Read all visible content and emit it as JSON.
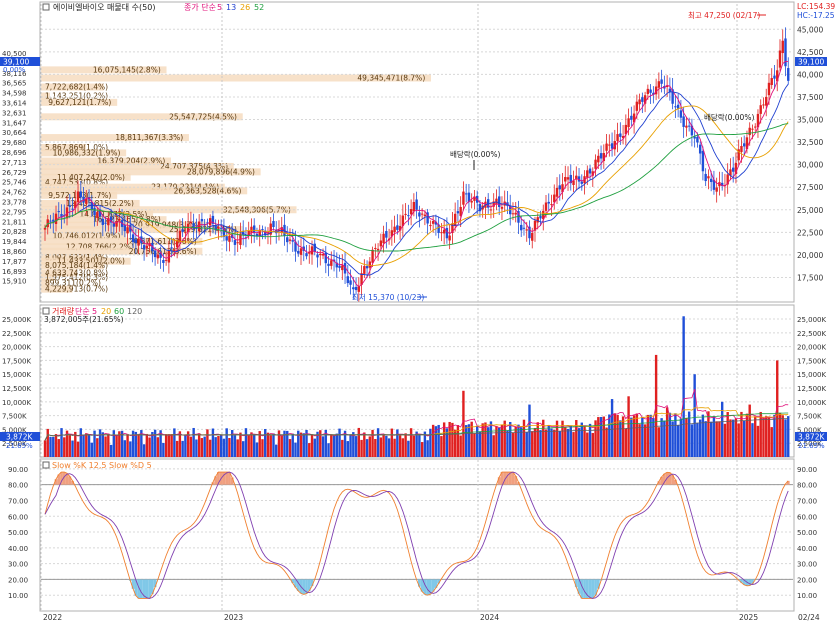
{
  "header": {
    "stock_name": "에이비엘바이오 매물대 수(50)",
    "ma_label": "종가 단순",
    "ma_periods": [
      "5",
      "13",
      "26",
      "52"
    ],
    "ma_colors": [
      "#e0107a",
      "#2040d0",
      "#e8a000",
      "#20a040"
    ],
    "lc": "LC:154.39",
    "hc": "HC:-17.25",
    "current_price": "39,100",
    "current_pct": "0.00%",
    "high_annot": "최고 47,250 (02/17)",
    "low_annot": "최저 15,370 (10/23)",
    "ex_div_1": "배당락(0.00%)",
    "ex_div_2": "배당락(0.00%)"
  },
  "volume_panel": {
    "label": "거래량",
    "ma_label": "단순",
    "ma_periods": [
      "5",
      "20",
      "60",
      "120"
    ],
    "ma_colors": [
      "#e0107a",
      "#e8a000",
      "#20a040",
      "#606060"
    ],
    "sub_label": "3,872,005주(21.65%)",
    "current": "3,872K",
    "current_pct": "21.65%"
  },
  "stoch_panel": {
    "label": "Slow %K 12,5  Slow %D 5",
    "k_color": "#f08030",
    "d_color": "#8040b0"
  },
  "colors": {
    "up": "#e02020",
    "down": "#1f4fd8",
    "profile": "#f6dcc0",
    "price_badge": "#1f4fd8"
  },
  "chart_data": {
    "type": "candlestick",
    "price_axis_right": [
      "45,000",
      "42,500",
      "40,000",
      "37,500",
      "35,000",
      "32,500",
      "30,000",
      "27,500",
      "25,000",
      "22,500",
      "20,000",
      "17,500"
    ],
    "price_axis_left": [
      "40,500",
      "39,100",
      "38,116",
      "36,565",
      "34,598",
      "33,614",
      "32,631",
      "31,647",
      "30,664",
      "29,680",
      "28,696",
      "27,713",
      "26,729",
      "25,746",
      "24,762",
      "23,778",
      "22,795",
      "21,811",
      "20,828",
      "19,844",
      "18,860",
      "17,877",
      "16,893",
      "15,910"
    ],
    "volume_axis": [
      "25,000K",
      "22,500K",
      "20,000K",
      "17,500K",
      "15,000K",
      "12,500K",
      "10,000K",
      "7,500K",
      "5,000K",
      "2,500K"
    ],
    "stoch_axis": [
      "90.00",
      "80.00",
      "70.00",
      "60.00",
      "50.00",
      "40.00",
      "30.00",
      "20.00",
      "10.00"
    ],
    "x_labels": [
      "2022",
      "2023",
      "2024",
      "2025",
      "02/24"
    ],
    "volume_profile": [
      {
        "price": 40500,
        "vol": "16,075,145(2.8%)",
        "pct": 2.8
      },
      {
        "price": 39600,
        "vol": "49,345,471(8.7%)",
        "pct": 8.7
      },
      {
        "price": 38600,
        "vol": "7,722,682(1.4%)",
        "pct": 1.4
      },
      {
        "price": 37600,
        "vol": "1,143,251(0.2%)",
        "pct": 0.2
      },
      {
        "price": 36900,
        "vol": "9,627,121(1.7%)",
        "pct": 1.7
      },
      {
        "price": 35300,
        "vol": "25,547,725(4.5%)",
        "pct": 4.5
      },
      {
        "price": 33000,
        "vol": "18,811,367(3.3%)",
        "pct": 3.3
      },
      {
        "price": 31900,
        "vol": "5,867,869(1.0%)",
        "pct": 1.0
      },
      {
        "price": 31300,
        "vol": "10,986,332(1.9%)",
        "pct": 1.9
      },
      {
        "price": 30400,
        "vol": "16,379,204(2.9%)",
        "pct": 2.9
      },
      {
        "price": 29800,
        "vol": "24,707,375(4.3%)",
        "pct": 4.3
      },
      {
        "price": 29200,
        "vol": "28,079,896(4.9%)",
        "pct": 4.9
      },
      {
        "price": 28600,
        "vol": "11,407,247(2.0%)",
        "pct": 2.0
      },
      {
        "price": 28000,
        "vol": "4,747,533(0.8%)",
        "pct": 0.8
      },
      {
        "price": 27500,
        "vol": "23,170,221(4.1%)",
        "pct": 4.1
      },
      {
        "price": 27100,
        "vol": "26,363,528(4.6%)",
        "pct": 4.6
      },
      {
        "price": 26600,
        "vol": "9,572,113(1.7%)",
        "pct": 1.7
      },
      {
        "price": 25700,
        "vol": "12,405,815(2.2%)",
        "pct": 2.2
      },
      {
        "price": 25000,
        "vol": "32,548,306(5.7%)",
        "pct": 5.7
      },
      {
        "price": 24500,
        "vol": "14,001,872(2.5%)",
        "pct": 2.5
      },
      {
        "price": 23900,
        "vol": "16,223,465(2.8%)",
        "pct": 2.8
      },
      {
        "price": 23300,
        "vol": "20,919,948(3.7%)",
        "pct": 3.7
      },
      {
        "price": 22800,
        "vol": "25,419,821(4.5%)",
        "pct": 4.5
      },
      {
        "price": 22100,
        "vol": "10,746,012(1.9%)",
        "pct": 1.9
      },
      {
        "price": 21500,
        "vol": "20,571,611(3.6%)",
        "pct": 3.6
      },
      {
        "price": 20900,
        "vol": "12,708,766(2.2%)",
        "pct": 2.2
      },
      {
        "price": 20400,
        "vol": "20,756,612(3.6%)",
        "pct": 3.6
      },
      {
        "price": 19700,
        "vol": "8,007,622(1.4%)",
        "pct": 1.4
      },
      {
        "price": 19300,
        "vol": "11,433,501(2.0%)",
        "pct": 2.0
      },
      {
        "price": 18800,
        "vol": "8,075,184(1.4%)",
        "pct": 1.4
      },
      {
        "price": 18000,
        "vol": "4,633,743(0.8%)",
        "pct": 0.8
      },
      {
        "price": 17500,
        "vol": "1,975,412(0.3%)",
        "pct": 0.3
      },
      {
        "price": 16900,
        "vol": "899,311(0.2%)",
        "pct": 0.2
      },
      {
        "price": 16200,
        "vol": "4,229,913(0.7%)",
        "pct": 0.7
      }
    ],
    "price_ylim": [
      15370,
      47250
    ],
    "volume_ylim": [
      0,
      27000
    ],
    "stoch_ylim": [
      0,
      95
    ]
  }
}
